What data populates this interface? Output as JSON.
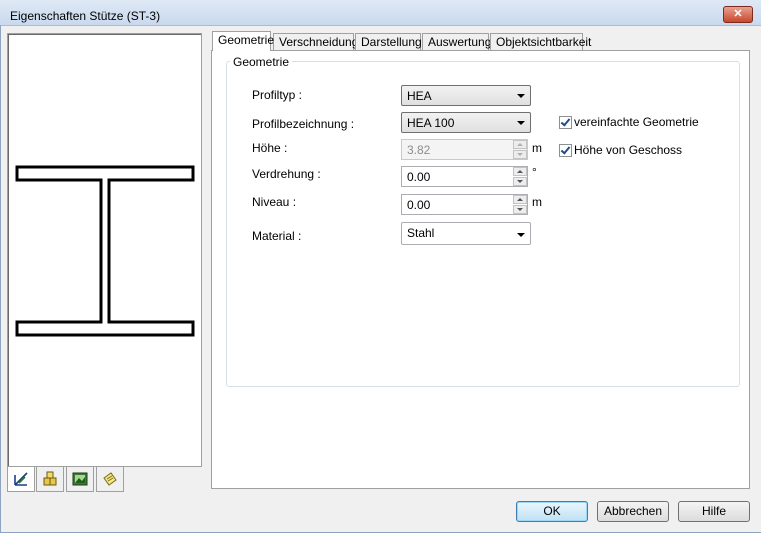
{
  "window": {
    "title": "Eigenschaften Stütze (ST-3)",
    "close_glyph": "✕"
  },
  "tabs": [
    {
      "label": "Geometrie",
      "active": true
    },
    {
      "label": "Verschneidung",
      "active": false
    },
    {
      "label": "Darstellung",
      "active": false
    },
    {
      "label": "Auswertung",
      "active": false
    },
    {
      "label": "Objektsichtbarkeit",
      "active": false
    }
  ],
  "group": {
    "title": "Geometrie"
  },
  "fields": {
    "profiltyp": {
      "label": "Profiltyp :",
      "value": "HEA"
    },
    "profilbezeichnung": {
      "label": "Profilbezeichnung :",
      "value": "HEA 100"
    },
    "hoehe": {
      "label": "Höhe :",
      "value": "3.82",
      "unit": "m",
      "disabled": true
    },
    "verdrehung": {
      "label": "Verdrehung :",
      "value": "0.00",
      "unit": "°"
    },
    "niveau": {
      "label": "Niveau :",
      "value": "0.00",
      "unit": "m"
    },
    "material": {
      "label": "Material :",
      "value": "Stahl"
    }
  },
  "checkboxes": {
    "vereinfacht": {
      "label": "vereinfachte Geometrie",
      "checked": true
    },
    "geschoss": {
      "label": "Höhe von Geschoss",
      "checked": true
    }
  },
  "tool_tabs": [
    "measure-icon",
    "blocks-icon",
    "picture-icon",
    "note-icon"
  ],
  "buttons": {
    "ok": "OK",
    "cancel": "Abbrechen",
    "help": "Hilfe"
  }
}
